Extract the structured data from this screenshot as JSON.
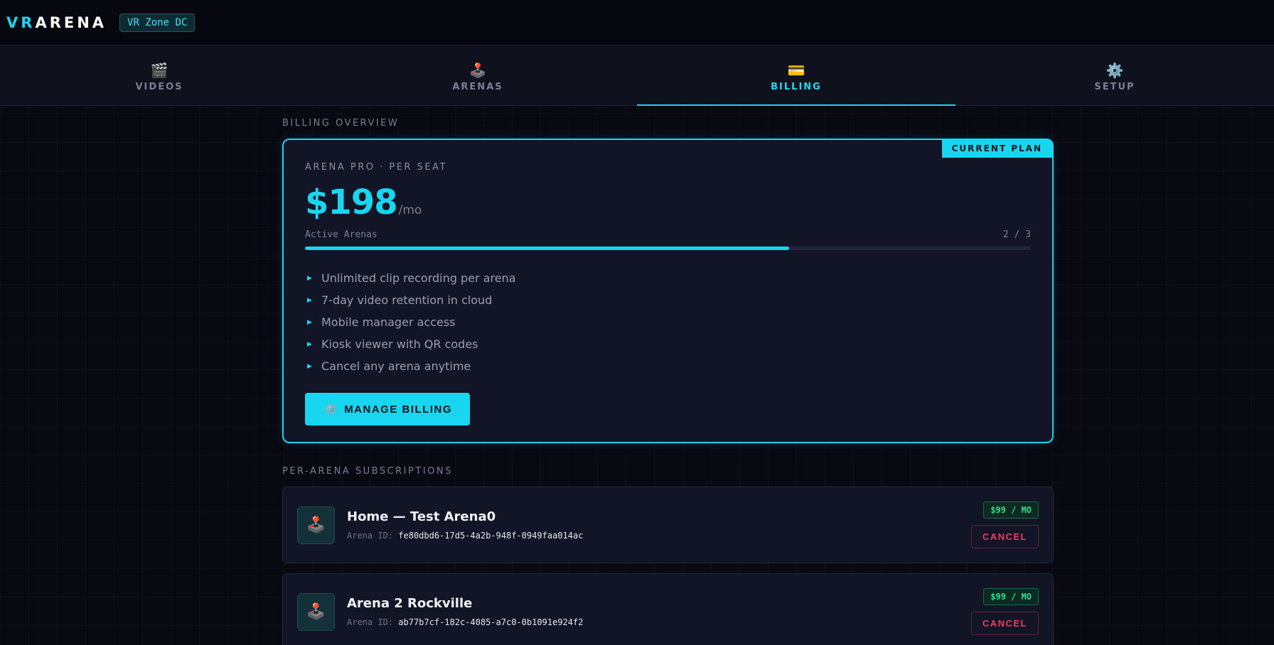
{
  "header": {
    "logo_accent": "VR",
    "logo_rest": "ARENA",
    "venue": "VR Zone DC"
  },
  "tabs": [
    {
      "label": "VIDEOS",
      "icon": "clapper-icon",
      "glyph": "🎬",
      "active": false
    },
    {
      "label": "ARENAS",
      "icon": "joystick-icon",
      "glyph": "🕹️",
      "active": false
    },
    {
      "label": "BILLING",
      "icon": "credit-card-icon",
      "glyph": "💳",
      "active": true
    },
    {
      "label": "SETUP",
      "icon": "gear-icon",
      "glyph": "⚙️",
      "active": false
    }
  ],
  "billing": {
    "section_label": "BILLING OVERVIEW",
    "current_plan_tag": "CURRENT PLAN",
    "plan_name": "ARENA PRO · PER SEAT",
    "price": "$198",
    "price_unit": "/mo",
    "usage_label": "Active Arenas",
    "usage_value": "2 / 3",
    "usage_fraction": 0.6667,
    "features": [
      "Unlimited clip recording per arena",
      "7-day video retention in cloud",
      "Mobile manager access",
      "Kiosk viewer with QR codes",
      "Cancel any arena anytime"
    ],
    "manage_button": "MANAGE BILLING",
    "manage_glyph": "⚙️"
  },
  "subscriptions": {
    "section_label": "PER-ARENA SUBSCRIPTIONS",
    "id_label": "Arena ID:",
    "items": [
      {
        "name": "Home — Test Arena0",
        "arena_id": "fe80dbd6-17d5-4a2b-948f-0949faa014ac",
        "price": "$99 / MO",
        "cancel": "CANCEL",
        "glyph": "🕹️"
      },
      {
        "name": "Arena 2 Rockville",
        "arena_id": "ab77b7cf-182c-4085-a7c0-0b1091e924f2",
        "price": "$99 / MO",
        "cancel": "CANCEL",
        "glyph": "🕹️"
      }
    ]
  },
  "colors": {
    "accent": "#19d6f0",
    "price_green": "#2ee08a",
    "cancel_red": "#ef3a66",
    "background": "#080911"
  }
}
